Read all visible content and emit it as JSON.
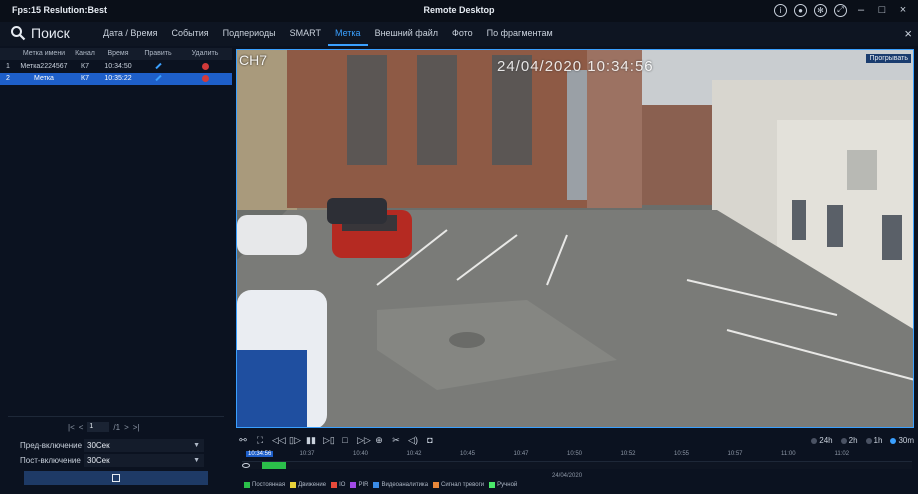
{
  "titlebar": {
    "fps_text": "Fps:15 Reslution:Best",
    "title": "Remote Desktop",
    "buttons": [
      "info-icon",
      "record-icon",
      "settings-icon",
      "fullscreen-icon",
      "minimize-icon",
      "maximize-icon",
      "close-icon"
    ]
  },
  "menubar": {
    "search_label": "Поиск",
    "tabs": [
      {
        "label": "Дата / Время",
        "active": false
      },
      {
        "label": "События",
        "active": false
      },
      {
        "label": "Подпериоды",
        "active": false
      },
      {
        "label": "SMART",
        "active": false
      },
      {
        "label": "Метка",
        "active": true
      },
      {
        "label": "Внешний файл",
        "active": false
      },
      {
        "label": "Фото",
        "active": false
      },
      {
        "label": "По фрагментам",
        "active": false
      }
    ],
    "close": "×"
  },
  "table": {
    "headers": [
      "",
      "Метка имени",
      "Канал",
      "Время",
      "Править",
      "Удалить"
    ],
    "rows": [
      {
        "idx": "1",
        "name": "Метка2224567",
        "channel": "К7",
        "time": "10:34:50",
        "selected": false
      },
      {
        "idx": "2",
        "name": "Метка",
        "channel": "К7",
        "time": "10:35:22",
        "selected": true
      }
    ]
  },
  "pager": {
    "first": "|<",
    "prev": "<",
    "page": "1",
    "total": "/1",
    "next": ">",
    "last": ">|"
  },
  "options": {
    "pre_label": "Пред-включение",
    "pre_value": "30Сек",
    "post_label": "Пост-включение",
    "post_value": "30Сек"
  },
  "video": {
    "channel_osd": "CH7",
    "time_osd": "24/04/2020   10:34:56",
    "play_button": "Прогрывать"
  },
  "controls": {
    "ranges": [
      {
        "label": "24h",
        "on": false
      },
      {
        "label": "2h",
        "on": false
      },
      {
        "label": "1h",
        "on": false
      },
      {
        "label": "30m",
        "on": true
      }
    ],
    "timeline_labels": [
      "10:34:56",
      "10:37",
      "10:40",
      "10:42",
      "10:45",
      "10:47",
      "10:50",
      "10:52",
      "10:55",
      "10:57",
      "11:00",
      "11:02"
    ],
    "recording": [
      {
        "start_fraction": 0.03,
        "end_fraction": 0.065
      }
    ],
    "date": "24/04/2020",
    "legend": [
      {
        "label": "Постоянная",
        "color": "#2bbf4a"
      },
      {
        "label": "Движение",
        "color": "#e8d23a"
      },
      {
        "label": "IO",
        "color": "#e84a3a"
      },
      {
        "label": "PIR",
        "color": "#a14ae8"
      },
      {
        "label": "Видеоаналитика",
        "color": "#3a8ce8"
      },
      {
        "label": "Сигнал тревоги",
        "color": "#e8873a"
      },
      {
        "label": "Ручной",
        "color": "#4ae86a"
      }
    ]
  },
  "colors": {
    "accent": "#3aa0ff",
    "selected_row": "#1e5fc9",
    "background": "#0b1220"
  }
}
